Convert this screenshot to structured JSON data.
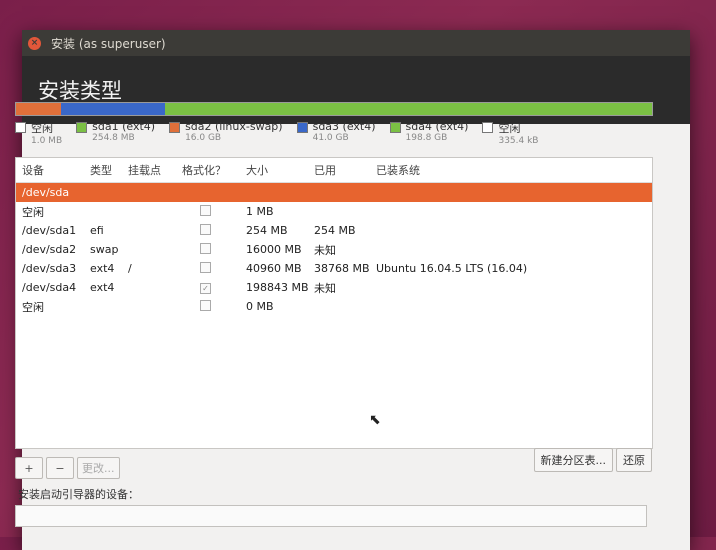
{
  "window": {
    "title": "安装 (as superuser)",
    "header": "安装类型"
  },
  "disk_bar": {
    "segments": [
      {
        "color": "#e0703a",
        "fraction": 0.07
      },
      {
        "color": "#3a68c9",
        "fraction": 0.165
      },
      {
        "color": "#7bc044",
        "fraction": 0.765
      }
    ]
  },
  "legend": [
    {
      "label": "空闲",
      "size": "1.0 MB",
      "color": "#ffffff"
    },
    {
      "label": "sda1 (ext4)",
      "size": "254.8 MB",
      "color": "#7bc044"
    },
    {
      "label": "sda2 (linux-swap)",
      "size": "16.0 GB",
      "color": "#e0703a"
    },
    {
      "label": "sda3 (ext4)",
      "size": "41.0 GB",
      "color": "#3a68c9"
    },
    {
      "label": "sda4 (ext4)",
      "size": "198.8 GB",
      "color": "#7bc044"
    },
    {
      "label": "空闲",
      "size": "335.4 kB",
      "color": "#ffffff"
    }
  ],
  "table": {
    "headers": [
      "设备",
      "类型",
      "挂载点",
      "格式化？",
      "大小",
      "已用",
      "已装系统"
    ],
    "disk": "/dev/sda",
    "rows": [
      {
        "device": "空闲",
        "type": "",
        "mount": "",
        "format": "",
        "size": "1 MB",
        "used": "",
        "os": ""
      },
      {
        "device": "/dev/sda1",
        "type": "efi",
        "mount": "",
        "format": "",
        "size": "254 MB",
        "used": "254 MB",
        "os": ""
      },
      {
        "device": "/dev/sda2",
        "type": "swap",
        "mount": "",
        "format": "",
        "size": "16000 MB",
        "used": "未知",
        "os": ""
      },
      {
        "device": "/dev/sda3",
        "type": "ext4",
        "mount": "/",
        "format": "",
        "size": "40960 MB",
        "used": "38768 MB",
        "os": "Ubuntu 16.04.5 LTS (16.04)"
      },
      {
        "device": "/dev/sda4",
        "type": "ext4",
        "mount": "",
        "format": "✓",
        "size": "198843 MB",
        "used": "未知",
        "os": ""
      },
      {
        "device": "空闲",
        "type": "",
        "mount": "",
        "format": "",
        "size": "0 MB",
        "used": "",
        "os": ""
      }
    ]
  },
  "toolbar": {
    "add": "+",
    "remove": "−",
    "change": "更改...",
    "new_table": "新建分区表...",
    "revert": "还原"
  },
  "bootloader": {
    "label": "安装启动引导器的设备："
  },
  "icons": {
    "close": "close-icon",
    "cursor": "mouse-pointer-icon"
  }
}
